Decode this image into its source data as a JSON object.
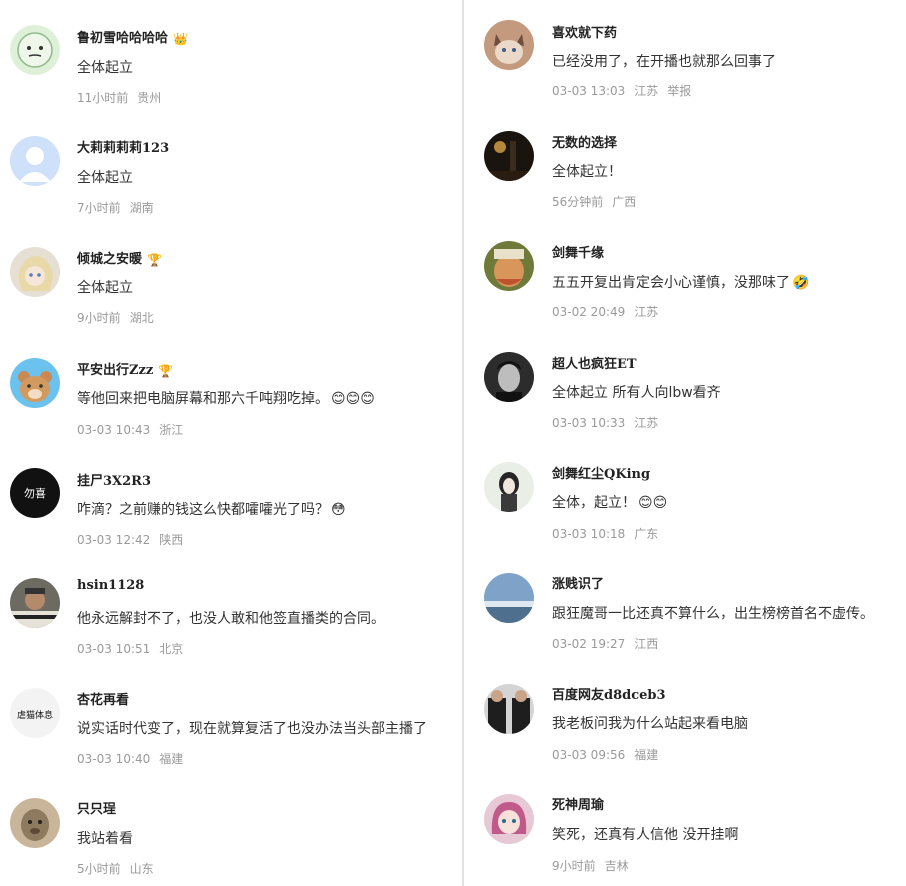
{
  "left_comments": [
    {
      "username": "鲁初雪哈哈哈哈",
      "badge": "👑",
      "text": "全体起立",
      "emoji": "",
      "time": "11小时前",
      "location": "贵州"
    },
    {
      "username": "大莉莉莉莉123",
      "badge": "",
      "text": "全体起立",
      "emoji": "",
      "time": "7小时前",
      "location": "湖南"
    },
    {
      "username": "倾城之安暖",
      "badge": "🏆",
      "text": "全体起立",
      "emoji": "",
      "time": "9小时前",
      "location": "湖北"
    },
    {
      "username": "平安出行Zzz",
      "badge": "🏆",
      "text": "等他回来把电脑屏幕和那六千吨翔吃掉。",
      "emoji": "😊😊😊",
      "time": "03-03 10:43",
      "location": "浙江"
    },
    {
      "username": "挂尸3X2R3",
      "badge": "",
      "text": "咋滴？之前赚的钱这么快都嚯嚯光了吗？",
      "emoji": "😳",
      "time": "03-03 12:42",
      "location": "陕西"
    },
    {
      "username": "hsin1128",
      "badge": "",
      "text": "他永远解封不了，也没人敢和他签直播类的合同。",
      "emoji": "",
      "time": "03-03 10:51",
      "location": "北京"
    },
    {
      "username": "杏花再看",
      "badge": "",
      "text": "说实话时代变了，现在就算复活了也没办法当头部主播了",
      "emoji": "",
      "time": "03-03 10:40",
      "location": "福建"
    },
    {
      "username": "只只珵",
      "badge": "",
      "text": "我站着看",
      "emoji": "",
      "time": "5小时前",
      "location": "山东"
    }
  ],
  "right_comments": [
    {
      "username": "喜欢就下药",
      "badge": "",
      "text": "已经没用了，在开播也就那么回事了",
      "emoji": "",
      "time": "03-03 13:03",
      "location": "江苏",
      "action": "举报"
    },
    {
      "username": "无数的选择",
      "badge": "",
      "text": "全体起立！",
      "emoji": "",
      "time": "56分钟前",
      "location": "广西"
    },
    {
      "username": "剑舞千缘",
      "badge": "",
      "text": "五五开复出肯定会小心谨慎，没那味了",
      "emoji": "🤣",
      "time": "03-02 20:49",
      "location": "江苏"
    },
    {
      "username": "超人也疯狂ET",
      "badge": "",
      "text": "全体起立 所有人向lbw看齐",
      "emoji": "",
      "time": "03-03 10:33",
      "location": "江苏"
    },
    {
      "username": "剑舞红尘QKing",
      "badge": "",
      "text": "全体，起立！",
      "emoji": "😊😊",
      "time": "03-03 10:18",
      "location": "广东"
    },
    {
      "username": "涨贱识了",
      "badge": "",
      "text": "跟狂魔哥一比还真不算什么，出生榜榜首名不虚传。",
      "emoji": "",
      "time": "03-02 19:27",
      "location": "江西"
    },
    {
      "username": "百度网友d8dceb3",
      "badge": "",
      "text": "我老板问我为什么站起来看电脑",
      "emoji": "",
      "time": "03-03 09:56",
      "location": "福建"
    },
    {
      "username": "死神周瑜",
      "badge": "",
      "text": "笑死，还真有人信他 没开挂啊",
      "emoji": "",
      "time": "9小时前",
      "location": "吉林"
    }
  ],
  "avatar_labels": {
    "left_5": "勿喜",
    "left_7": "虐猫体息"
  },
  "colors": {
    "meta": "#9a9a9a",
    "name": "#222222",
    "text": "#333333",
    "divider": "#e2e2e2"
  }
}
